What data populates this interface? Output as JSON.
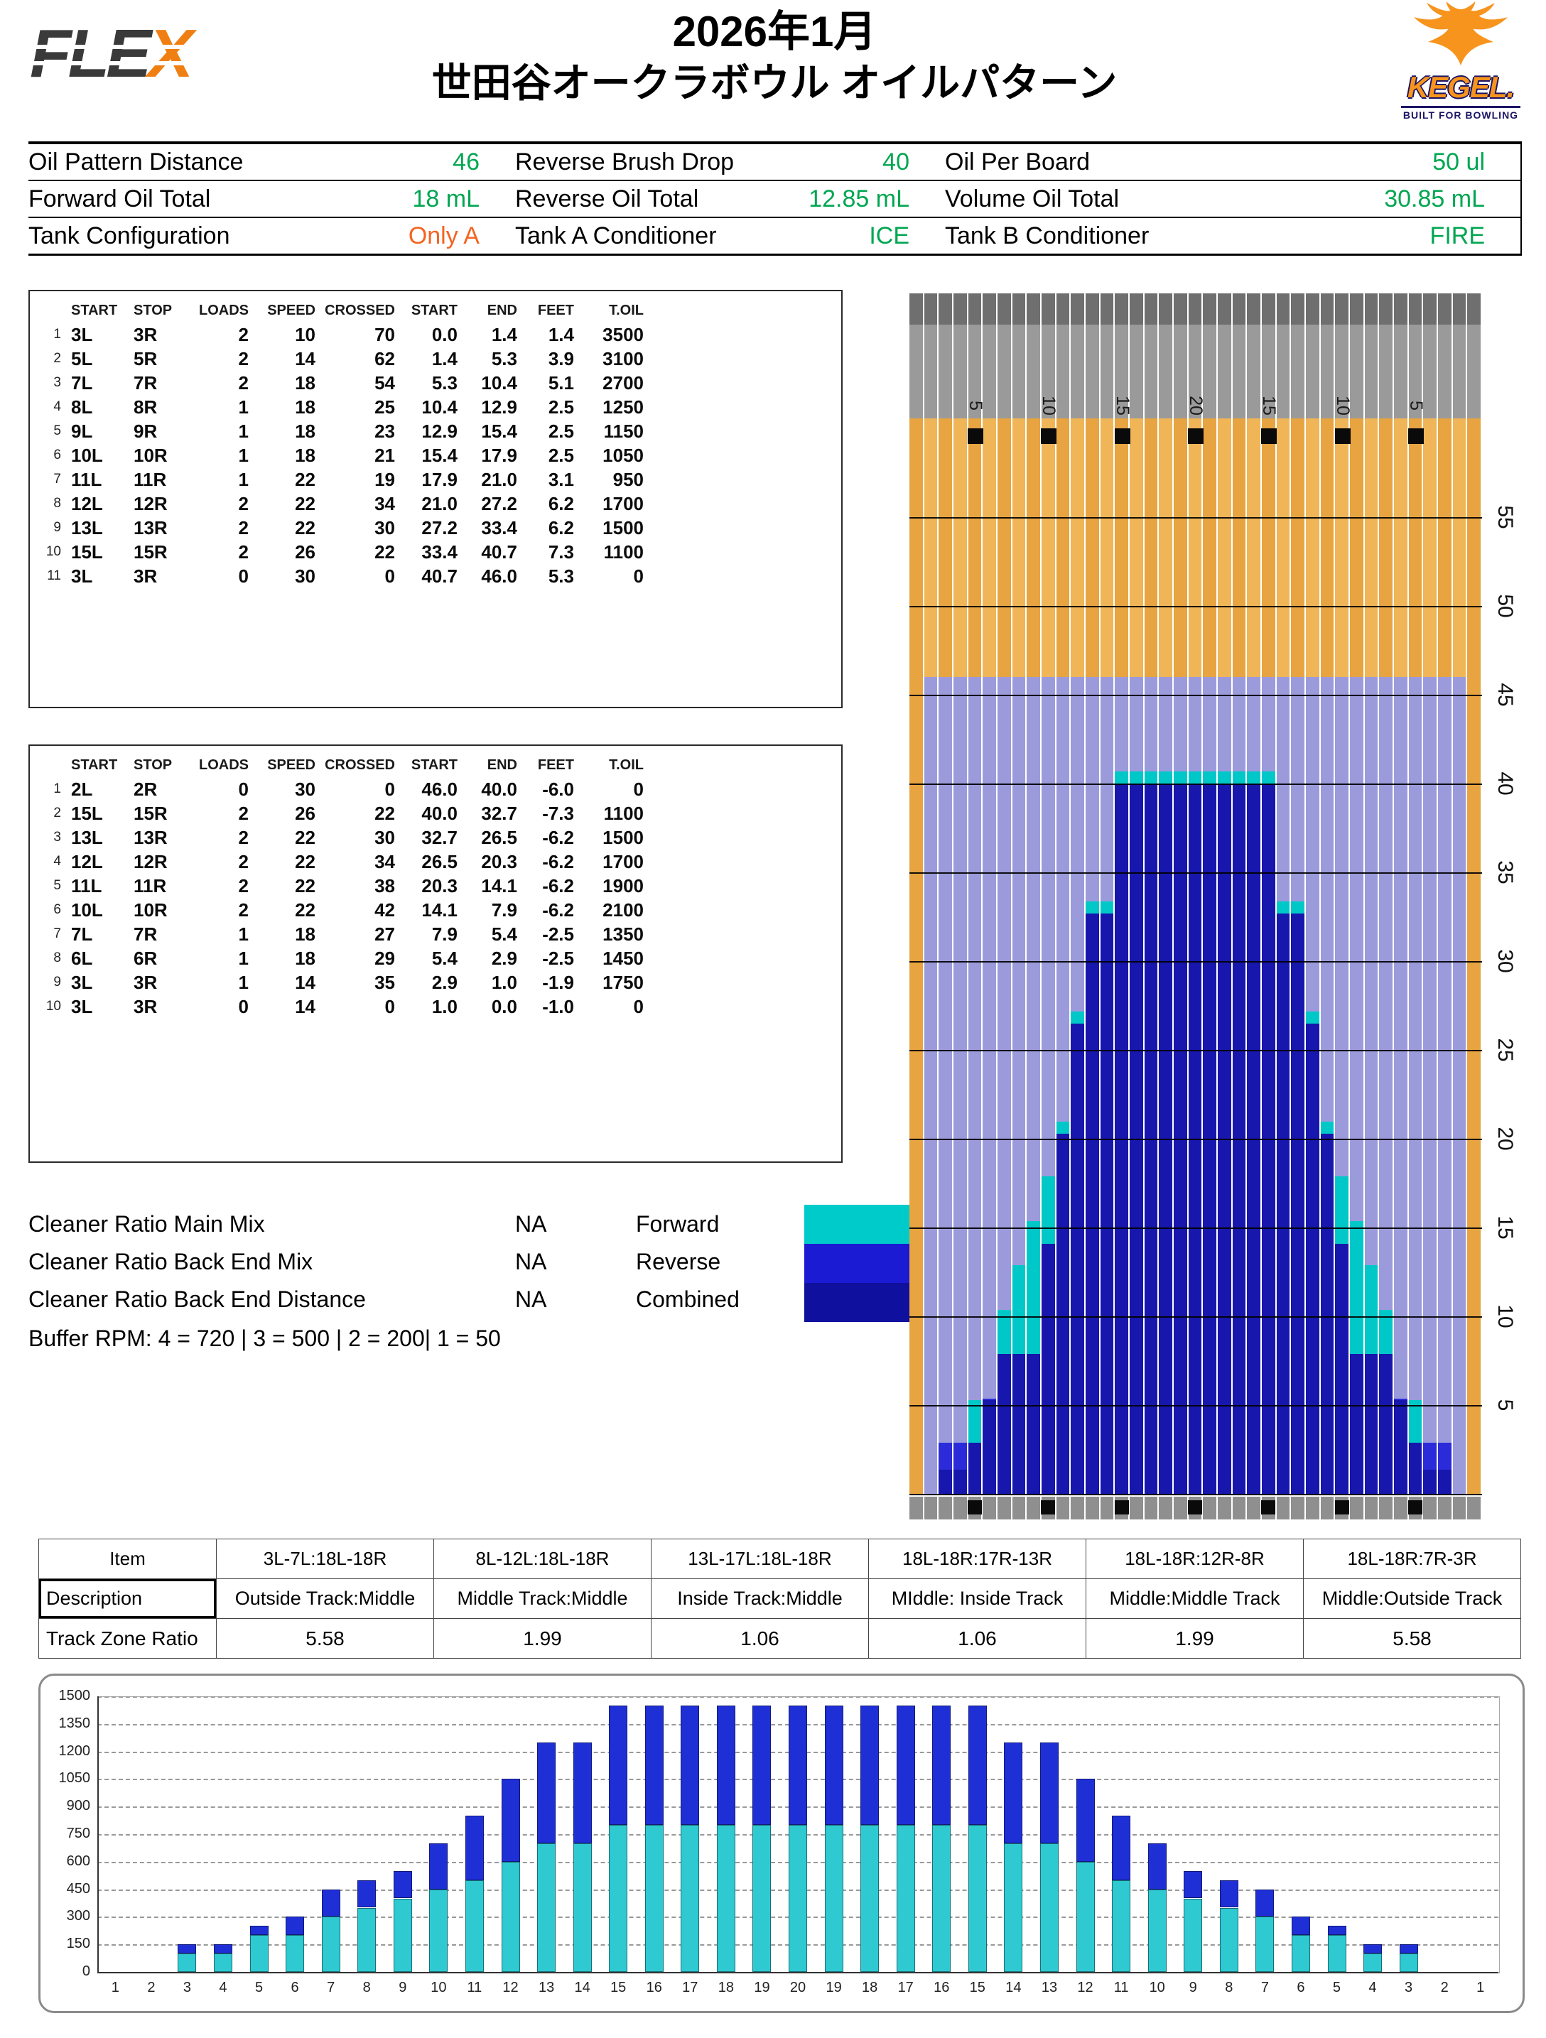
{
  "header": {
    "brand": {
      "part1": "FLE",
      "part2": "X"
    },
    "title_line1": "2026年1月",
    "title_line2": "世田谷オークラボウル オイルパターン",
    "logo": {
      "name": "KEGEL.",
      "tagline": "BUILT FOR BOWLING"
    }
  },
  "info": {
    "rows": [
      {
        "cells": [
          {
            "label": "Oil Pattern Distance",
            "value": "46",
            "color": "#00A651"
          },
          {
            "label": "Reverse Brush Drop",
            "value": "40",
            "color": "#00A651"
          },
          {
            "label": "Oil Per Board",
            "value": "50 ul",
            "color": "#00A651"
          }
        ]
      },
      {
        "cells": [
          {
            "label": "Forward Oil Total",
            "value": "18 mL",
            "color": "#00A651"
          },
          {
            "label": "Reverse Oil Total",
            "value": "12.85 mL",
            "color": "#00A651"
          },
          {
            "label": "Volume Oil Total",
            "value": "30.85 mL",
            "color": "#00A651"
          }
        ]
      },
      {
        "cells": [
          {
            "label": "Tank Configuration",
            "value": "Only A",
            "color": "#F26522"
          },
          {
            "label": "Tank A Conditioner",
            "value": "ICE",
            "color": "#00A651"
          },
          {
            "label": "Tank B Conditioner",
            "value": "FIRE",
            "color": "#00A651"
          }
        ]
      }
    ]
  },
  "load_tables": {
    "columns": [
      "START",
      "STOP",
      "LOADS",
      "SPEED",
      "CROSSED",
      "START",
      "END",
      "FEET",
      "T.OIL"
    ],
    "forward_rows": [
      [
        "3L",
        "3R",
        "2",
        "10",
        "70",
        "0.0",
        "1.4",
        "1.4",
        "3500"
      ],
      [
        "5L",
        "5R",
        "2",
        "14",
        "62",
        "1.4",
        "5.3",
        "3.9",
        "3100"
      ],
      [
        "7L",
        "7R",
        "2",
        "18",
        "54",
        "5.3",
        "10.4",
        "5.1",
        "2700"
      ],
      [
        "8L",
        "8R",
        "1",
        "18",
        "25",
        "10.4",
        "12.9",
        "2.5",
        "1250"
      ],
      [
        "9L",
        "9R",
        "1",
        "18",
        "23",
        "12.9",
        "15.4",
        "2.5",
        "1150"
      ],
      [
        "10L",
        "10R",
        "1",
        "18",
        "21",
        "15.4",
        "17.9",
        "2.5",
        "1050"
      ],
      [
        "11L",
        "11R",
        "1",
        "22",
        "19",
        "17.9",
        "21.0",
        "3.1",
        "950"
      ],
      [
        "12L",
        "12R",
        "2",
        "22",
        "34",
        "21.0",
        "27.2",
        "6.2",
        "1700"
      ],
      [
        "13L",
        "13R",
        "2",
        "22",
        "30",
        "27.2",
        "33.4",
        "6.2",
        "1500"
      ],
      [
        "15L",
        "15R",
        "2",
        "26",
        "22",
        "33.4",
        "40.7",
        "7.3",
        "1100"
      ],
      [
        "3L",
        "3R",
        "0",
        "30",
        "0",
        "40.7",
        "46.0",
        "5.3",
        "0"
      ]
    ],
    "reverse_rows": [
      [
        "2L",
        "2R",
        "0",
        "30",
        "0",
        "46.0",
        "40.0",
        "-6.0",
        "0"
      ],
      [
        "15L",
        "15R",
        "2",
        "26",
        "22",
        "40.0",
        "32.7",
        "-7.3",
        "1100"
      ],
      [
        "13L",
        "13R",
        "2",
        "22",
        "30",
        "32.7",
        "26.5",
        "-6.2",
        "1500"
      ],
      [
        "12L",
        "12R",
        "2",
        "22",
        "34",
        "26.5",
        "20.3",
        "-6.2",
        "1700"
      ],
      [
        "11L",
        "11R",
        "2",
        "22",
        "38",
        "20.3",
        "14.1",
        "-6.2",
        "1900"
      ],
      [
        "10L",
        "10R",
        "2",
        "22",
        "42",
        "14.1",
        "7.9",
        "-6.2",
        "2100"
      ],
      [
        "7L",
        "7R",
        "1",
        "18",
        "27",
        "7.9",
        "5.4",
        "-2.5",
        "1350"
      ],
      [
        "6L",
        "6R",
        "1",
        "18",
        "29",
        "5.4",
        "2.9",
        "-2.5",
        "1450"
      ],
      [
        "3L",
        "3R",
        "1",
        "14",
        "35",
        "2.9",
        "1.0",
        "-1.9",
        "1750"
      ],
      [
        "3L",
        "3R",
        "0",
        "14",
        "0",
        "1.0",
        "0.0",
        "-1.0",
        "0"
      ]
    ]
  },
  "cleaner": {
    "items": [
      {
        "label": "Cleaner Ratio Main Mix",
        "value": "NA"
      },
      {
        "label": "Cleaner Ratio Back End Mix",
        "value": "NA"
      },
      {
        "label": "Cleaner Ratio Back End Distance",
        "value": "NA"
      }
    ],
    "buffer_rpm": "Buffer RPM: 4 = 720 | 3 = 500 | 2 = 200| 1 = 50",
    "legend": [
      {
        "label": "Forward",
        "color": "#00CBCB"
      },
      {
        "label": "Reverse",
        "color": "#1B1BD4"
      },
      {
        "label": "Combined",
        "color": "#10109E"
      }
    ]
  },
  "lane": {
    "boards": 39,
    "pattern_distance_ft": 46,
    "board_markers": [
      5,
      10,
      15,
      20,
      25,
      30,
      35
    ],
    "board_marker_labels": [
      "5",
      "10",
      "15",
      "20",
      "15",
      "10",
      "5"
    ],
    "distance_labels": [
      5,
      10,
      15,
      20,
      25,
      30,
      35,
      40,
      45,
      50,
      55
    ],
    "colors": {
      "wood": "#E7A440",
      "wood_alt": "#EFB557",
      "buff": "#9B9BDC",
      "forward": "#00C8C8",
      "reverse": "#2B2BD9",
      "combined": "#1717AE",
      "pindeck": "#9A9A9A",
      "pindeck_dark": "#6F6F6F",
      "strip": "#8F8F8F"
    }
  },
  "track": {
    "header": [
      "Item",
      "3L-7L:18L-18R",
      "8L-12L:18L-18R",
      "13L-17L:18L-18R",
      "18L-18R:17R-13R",
      "18L-18R:12R-8R",
      "18L-18R:7R-3R"
    ],
    "description_label": "Description",
    "descriptions": [
      "Outside Track:Middle",
      "Middle Track:Middle",
      "Inside Track:Middle",
      "MIddle: Inside Track",
      "Middle:Middle Track",
      "Middle:Outside Track"
    ],
    "ratio_label": "Track Zone Ratio",
    "ratios": [
      "5.58",
      "1.99",
      "1.06",
      "1.06",
      "1.99",
      "5.58"
    ]
  },
  "chart_data": {
    "type": "bar",
    "stacked": true,
    "title": "",
    "xlabel": "",
    "ylabel": "",
    "ylim": [
      0,
      1500
    ],
    "ytick_interval": 150,
    "grid": true,
    "x_labels": [
      1,
      2,
      3,
      4,
      5,
      6,
      7,
      8,
      9,
      10,
      11,
      12,
      13,
      14,
      15,
      16,
      17,
      18,
      19,
      20,
      19,
      18,
      17,
      16,
      15,
      14,
      13,
      12,
      11,
      10,
      9,
      8,
      7,
      6,
      5,
      4,
      3,
      2,
      1
    ],
    "series": [
      {
        "name": "Forward",
        "color": "#2FC9D2",
        "values": [
          0,
          0,
          100,
          100,
          200,
          200,
          300,
          350,
          400,
          450,
          500,
          600,
          700,
          700,
          800,
          800,
          800,
          800,
          800,
          800,
          800,
          800,
          800,
          800,
          800,
          700,
          700,
          600,
          500,
          450,
          400,
          350,
          300,
          200,
          200,
          100,
          100,
          0,
          0
        ]
      },
      {
        "name": "Reverse",
        "color": "#1F2FD6",
        "values": [
          0,
          0,
          50,
          50,
          50,
          100,
          150,
          150,
          150,
          250,
          350,
          450,
          550,
          550,
          650,
          650,
          650,
          650,
          650,
          650,
          650,
          650,
          650,
          650,
          650,
          550,
          550,
          450,
          350,
          250,
          150,
          150,
          150,
          100,
          50,
          50,
          50,
          0,
          0
        ]
      }
    ]
  }
}
